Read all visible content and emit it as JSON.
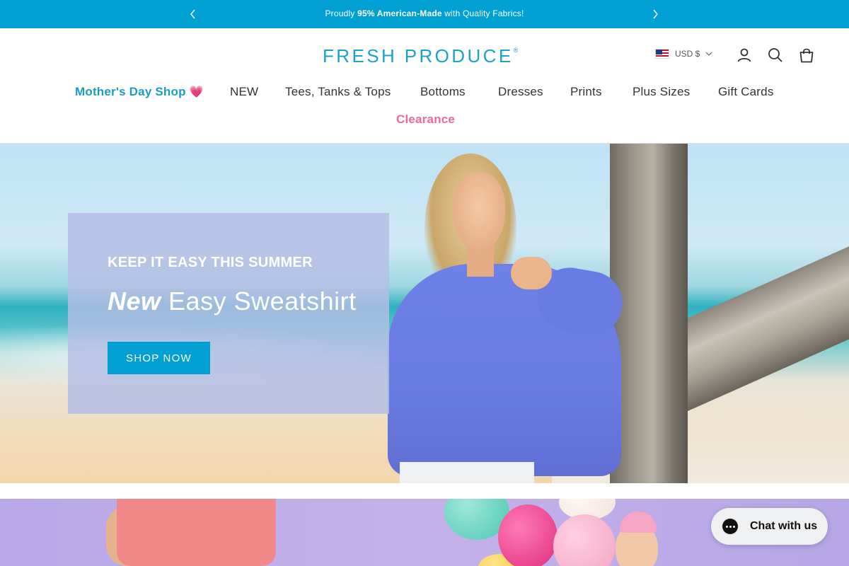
{
  "announcement": {
    "prefix": "Proudly ",
    "bold": "95% American-Made",
    "suffix": " with Quality Fabrics!"
  },
  "header": {
    "logo": "FRESH PRODUCE",
    "logo_mark": "®",
    "currency": "USD $"
  },
  "nav": {
    "items": [
      {
        "label": "Mother's Day Shop",
        "emoji": "💗"
      },
      {
        "label": "NEW"
      },
      {
        "label": "Tees, Tanks & Tops"
      },
      {
        "label": "Bottoms"
      },
      {
        "label": "Dresses"
      },
      {
        "label": "Prints"
      },
      {
        "label": "Plus Sizes"
      },
      {
        "label": "Gift Cards"
      },
      {
        "label": "Clearance"
      }
    ]
  },
  "hero": {
    "eyebrow": "KEEP IT EASY THIS SUMMER",
    "headline_em": "New",
    "headline_rest": " Easy Sweatshirt",
    "cta": "SHOP NOW"
  },
  "chat": {
    "label": "Chat with us"
  },
  "colors": {
    "brand": "#00a0d2",
    "logo": "#1aa3c8",
    "mothers_day": "#1a9cc6",
    "clearance": "#ec6b9a"
  }
}
